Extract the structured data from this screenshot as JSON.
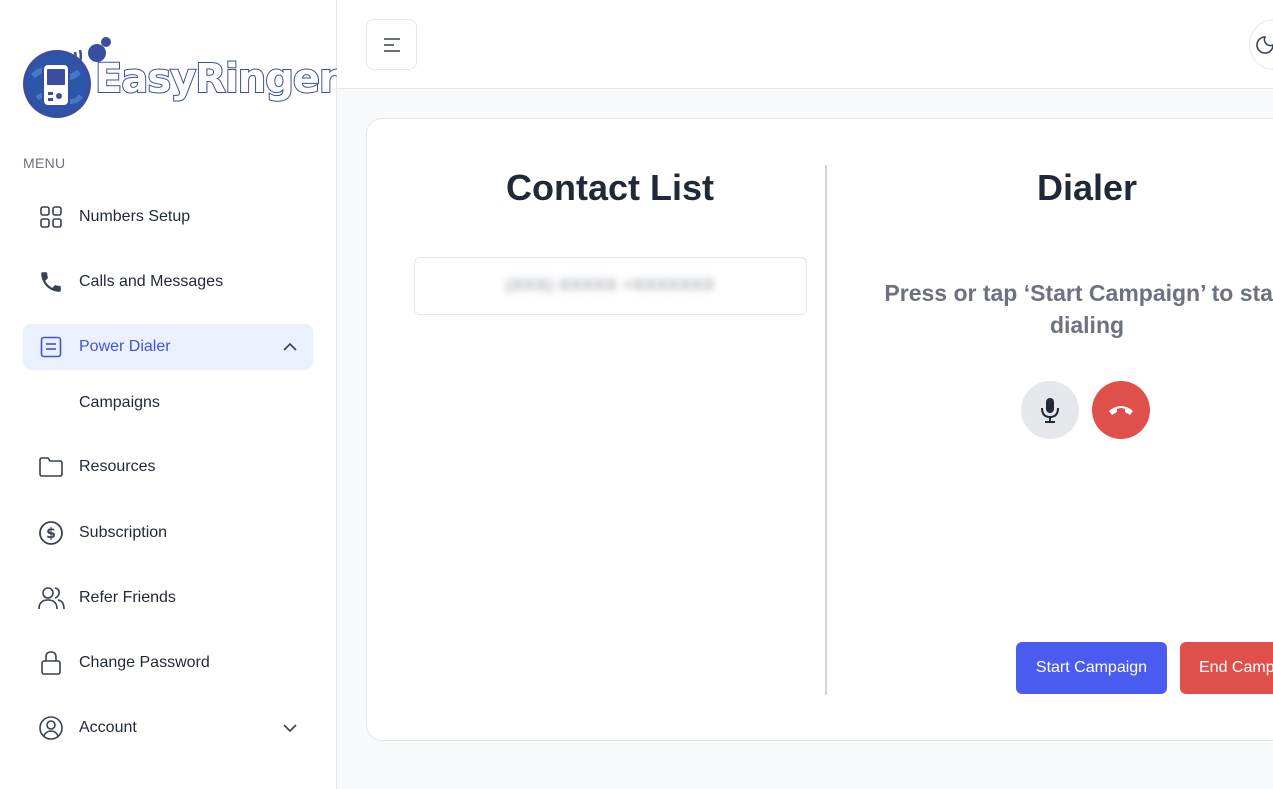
{
  "brand": {
    "name": "EasyRinger"
  },
  "sidebar": {
    "menu_label": "MENU",
    "items": [
      {
        "label": "Numbers Setup",
        "icon": "grid-icon"
      },
      {
        "label": "Calls and Messages",
        "icon": "phone-icon"
      },
      {
        "label": "Power Dialer",
        "icon": "document-icon",
        "active": true,
        "expanded": true
      },
      {
        "label": "Resources",
        "icon": "folder-icon"
      },
      {
        "label": "Subscription",
        "icon": "dollar-icon"
      },
      {
        "label": "Refer Friends",
        "icon": "users-icon"
      },
      {
        "label": "Change Password",
        "icon": "lock-icon"
      },
      {
        "label": "Account",
        "icon": "user-circle-icon",
        "expanded": false
      }
    ],
    "subitems": [
      {
        "label": "Campaigns"
      }
    ]
  },
  "header": {
    "menu_toggle_icon": "menu-icon"
  },
  "contact_list": {
    "title": "Contact List",
    "entries": [
      {
        "text": "(XXX) XXXXX +XXXXXXX"
      }
    ]
  },
  "dialer": {
    "title": "Dialer",
    "message": "Press or tap ‘Start Campaign’ to start dialing",
    "start_label": "Start Campaign",
    "end_label": "End Campaign"
  },
  "colors": {
    "accent": "#4a5cf0",
    "danger": "#e0504a",
    "active_bg": "#eaf0fc",
    "active_text": "#4451d9"
  }
}
